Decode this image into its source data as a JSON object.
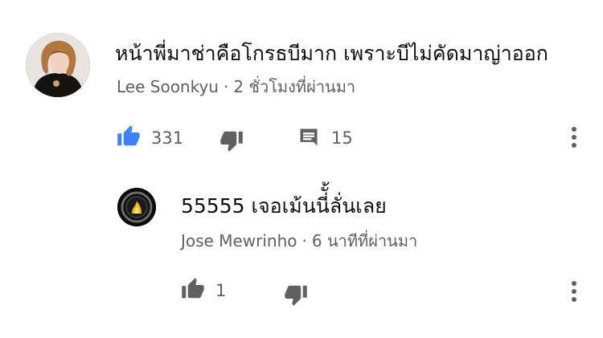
{
  "comment": {
    "author": "Lee Soonkyu",
    "time": "2 ชั่วโมงที่ผ่านมา",
    "text": "หน้าพี่มาช่าคือโกรธบีมาก เพราะบีไม่คัดมาญ่าออก",
    "likes": "331",
    "replies": "15",
    "like_state": "liked",
    "like_color": "#3e82f7",
    "icons": [
      "thumb-up-icon",
      "thumb-down-icon",
      "reply-icon",
      "more-vert-icon"
    ]
  },
  "reply": {
    "author": "Jose Mewrinho",
    "time": "6 นาทีที่ผ่านมา",
    "text": "55555 เจอเม้นนี่ั้ลั่นเลย",
    "likes": "1",
    "icons": [
      "thumb-up-icon",
      "thumb-down-icon",
      "more-vert-icon"
    ]
  },
  "separator": "·",
  "colors": {
    "text": "#0f0f0f",
    "secondary": "#606060",
    "background": "#ffffff"
  }
}
